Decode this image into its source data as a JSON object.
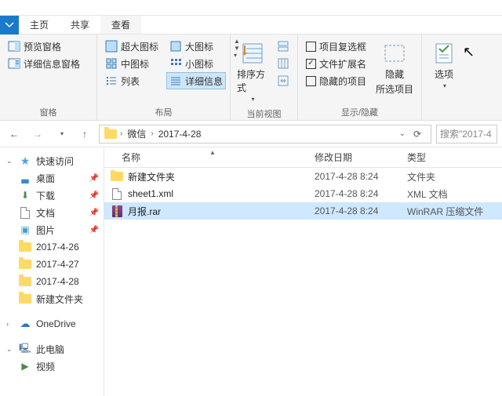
{
  "tabs": {
    "home": "主页",
    "share": "共享",
    "view": "查看"
  },
  "ribbon": {
    "panes": {
      "preview": "预览窗格",
      "details": "详细信息窗格",
      "group_label": "窗格"
    },
    "layout": {
      "extra_large": "超大图标",
      "large": "大图标",
      "medium": "中图标",
      "small": "小图标",
      "list": "列表",
      "details": "详细信息",
      "group_label": "布局"
    },
    "current": {
      "sort": "排序方式",
      "group_label": "当前视图"
    },
    "showhide": {
      "checkboxes": "项目复选框",
      "extensions": "文件扩展名",
      "hidden_items": "隐藏的项目",
      "hide_selected_top": "隐藏",
      "hide_selected_bottom": "所选项目",
      "group_label": "显示/隐藏"
    },
    "options": "选项"
  },
  "breadcrumb": {
    "parent": "微信",
    "current": "2017-4-28"
  },
  "search_placeholder": "搜索\"2017-4",
  "nav": {
    "quick": "快速访问",
    "desktop": "桌面",
    "downloads": "下载",
    "documents": "文档",
    "pictures": "图片",
    "f1": "2017-4-26",
    "f2": "2017-4-27",
    "f3": "2017-4-28",
    "f4": "新建文件夹",
    "onedrive": "OneDrive",
    "thispc": "此电脑",
    "videos": "视频"
  },
  "columns": {
    "name": "名称",
    "date": "修改日期",
    "type": "类型"
  },
  "files": {
    "r0": {
      "name": "新建文件夹",
      "date": "2017-4-28 8:24",
      "type": "文件夹"
    },
    "r1": {
      "name": "sheet1.xml",
      "date": "2017-4-28 8:24",
      "type": "XML 文档"
    },
    "r2": {
      "name": "月报.rar",
      "date": "2017-4-28 8:24",
      "type": "WinRAR 压缩文件"
    }
  }
}
